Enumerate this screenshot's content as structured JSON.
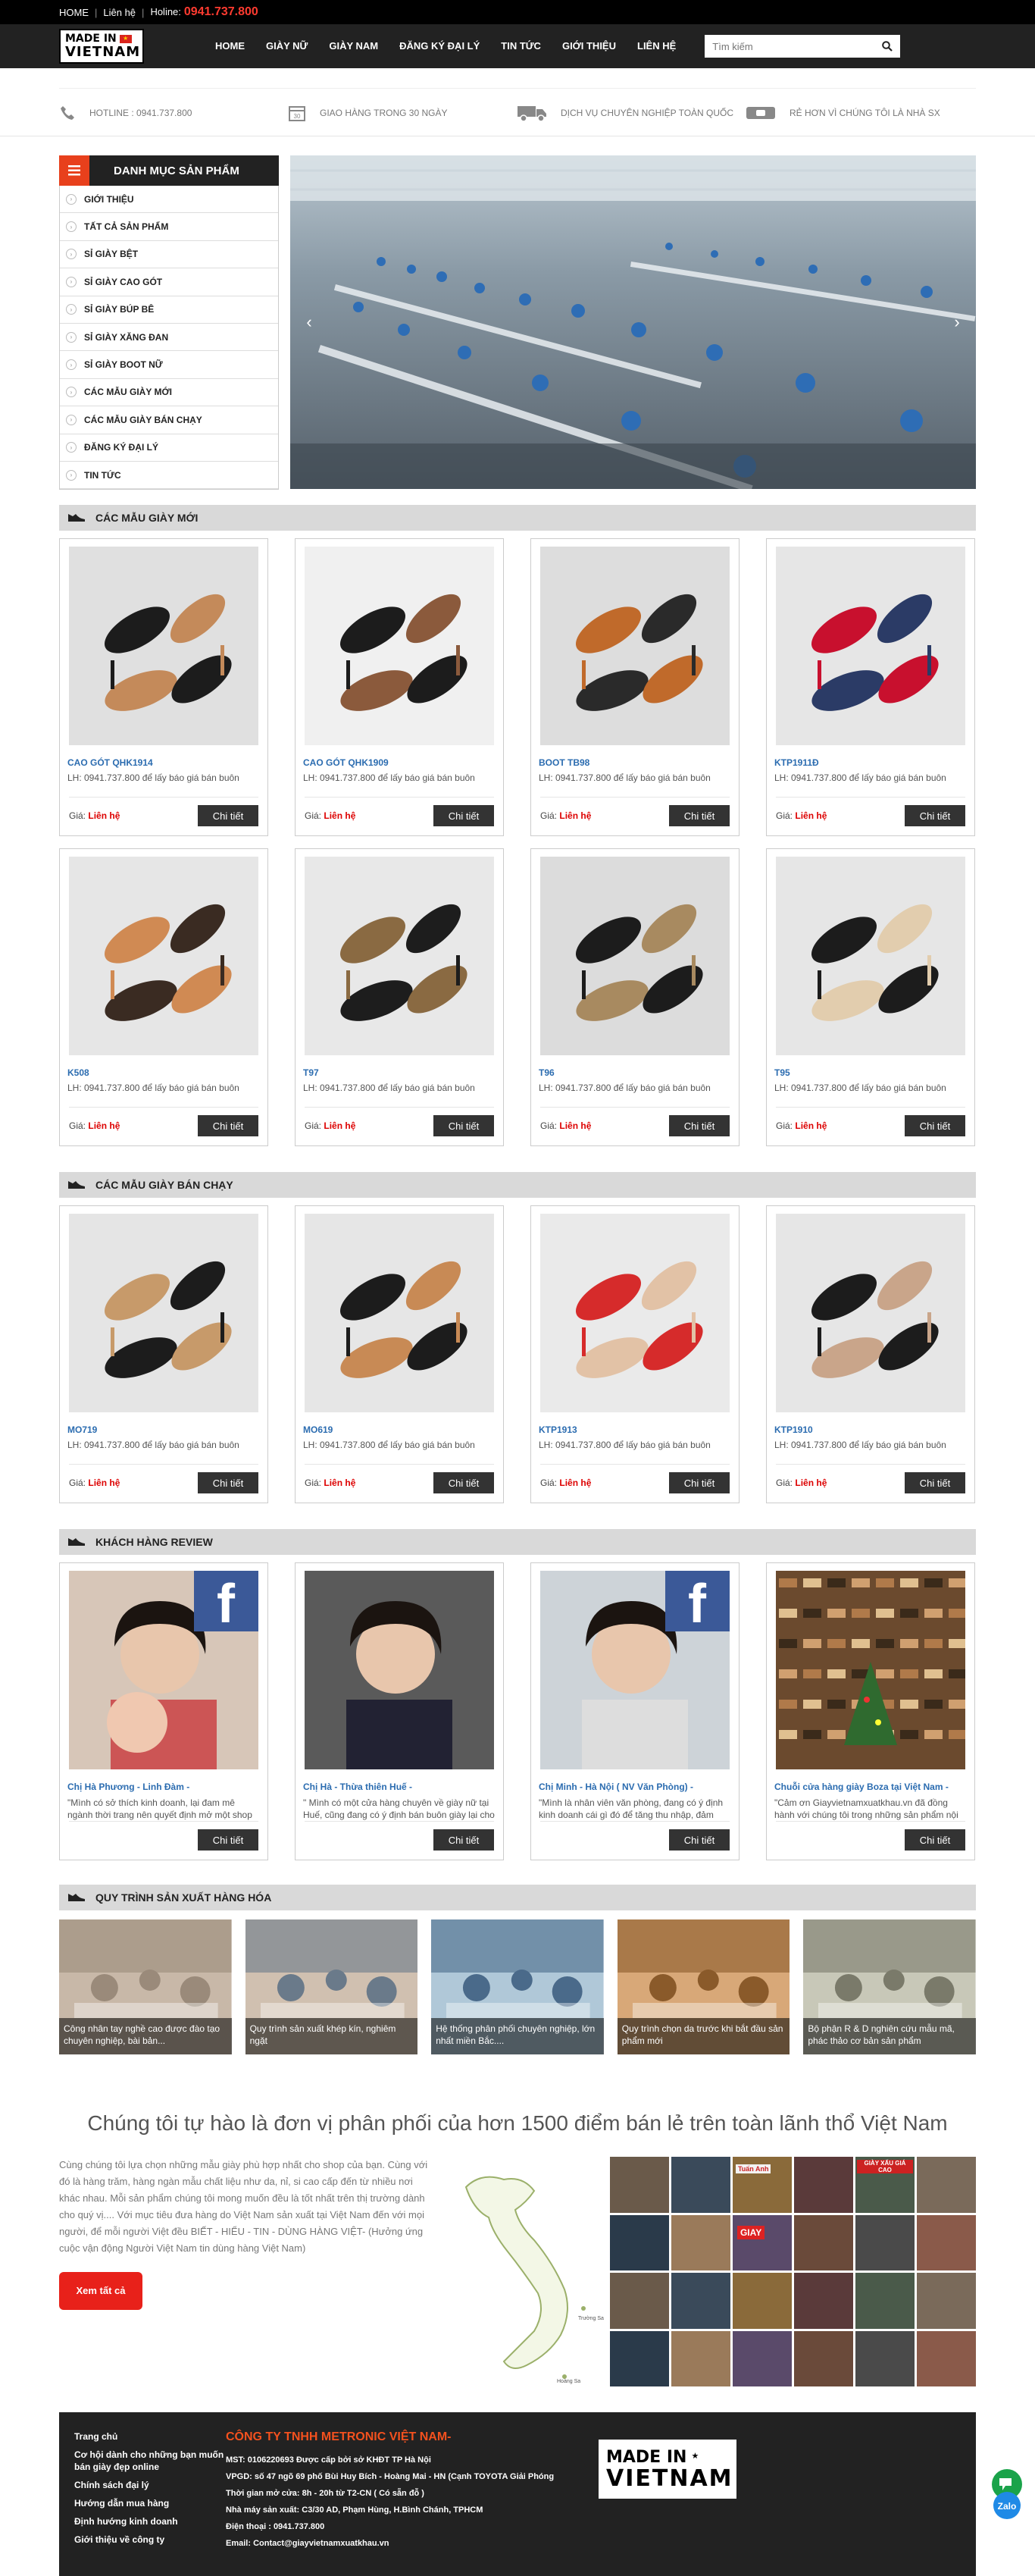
{
  "topbar": {
    "home": "HOME",
    "contact": "Liên hệ",
    "hotline_label": "Holine:",
    "hotline_number": "0941.737.800"
  },
  "logo": {
    "line1": "MADE IN",
    "line2": "VIETNAM"
  },
  "nav": [
    "HOME",
    "GIÀY NỮ",
    "GIÀY NAM",
    "ĐĂNG KÝ ĐẠI LÝ",
    "TIN TỨC",
    "GIỚI THIỆU",
    "LIÊN HỆ"
  ],
  "search": {
    "placeholder": "Tìm kiếm"
  },
  "features": [
    {
      "icon": "phone-icon",
      "text": "HOTLINE : 0941.737.800"
    },
    {
      "icon": "calendar-icon",
      "text": "GIAO HÀNG TRONG 30 NGÀY"
    },
    {
      "icon": "truck-icon",
      "text": "DỊCH VỤ CHUYÊN NGHIỆP TOÀN QUỐC"
    },
    {
      "icon": "wallet-icon",
      "text": "RẺ HƠN VÌ CHÚNG TÔI LÀ NHÀ SX"
    }
  ],
  "categories": {
    "title": "DANH MỤC SẢN PHẨM",
    "items": [
      "GIỚI THIỆU",
      "TẤT CẢ SẢN PHẨM",
      "SỈ GIÀY BỆT",
      "SỈ GIÀY CAO GÓT",
      "SỈ GIÀY BÚP BÊ",
      "SỈ GIÀY XĂNG ĐAN",
      "SỈ GIÀY BOOT NỮ",
      "CÁC MẪU GIÀY MỚI",
      "CÁC MẪU GIÀY BÁN CHẠY",
      "ĐĂNG KÝ ĐẠI LÝ",
      "TIN TỨC"
    ]
  },
  "sections": {
    "new": "CÁC MẪU GIÀY MỚI",
    "best": "CÁC MẪU GIÀY BÁN CHẠY",
    "review": "KHÁCH HÀNG REVIEW",
    "process": "QUY TRÌNH SẢN XUẤT HÀNG HÓA"
  },
  "product_common": {
    "desc": "LH: 0941.737.800 để lấy báo giá bán buôn",
    "price_label": "Giá:",
    "price_value": "Liên hệ",
    "button": "Chi tiết"
  },
  "new_products": [
    {
      "name": "CAO GÓT QHK1914",
      "tag": ""
    },
    {
      "name": "CAO GÓT QHK1909",
      "tag": ""
    },
    {
      "name": "BOOT TB98",
      "tag": "TB98"
    },
    {
      "name": "KTP1911Đ",
      "tag": "KTP1911Đ"
    },
    {
      "name": "K508",
      "tag": ""
    },
    {
      "name": "T97",
      "tag": ""
    },
    {
      "name": "T96",
      "tag": ""
    },
    {
      "name": "T95",
      "tag": ""
    }
  ],
  "best_products": [
    {
      "name": "MO719"
    },
    {
      "name": "MO619"
    },
    {
      "name": "KTP1913"
    },
    {
      "name": "KTP1910"
    }
  ],
  "reviews": [
    {
      "name": "Chị Hà Phương - Linh Đàm -",
      "text": "\"Mình có sở thích kinh doanh, lại đam mê ngành thời trang nên quyết định mở một shop"
    },
    {
      "name": "Chị Hà - Thừa thiên Huế -",
      "text": "\" Mình có một cửa hàng chuyên về giày nữ tại Huế, cũng đang có ý định bán buôn giày lại cho"
    },
    {
      "name": "Chị Minh - Hà Nội ( NV Văn Phòng) -",
      "text": "\"Mình là nhân viên văn phòng, đang có ý định kinh doanh cái gì đó để tăng thu nhập, đảm"
    },
    {
      "name": "Chuỗi cửa hàng giày Boza tại Việt Nam -",
      "text": "\"Cảm ơn Giayvietnamxuatkhau.vn đã đồng hành với chúng tôi trong những sản phẩm nội"
    }
  ],
  "process": [
    "Công nhân tay nghề cao được đào tạo chuyên nghiệp, bài bản...",
    "Quy trình sản xuất khép kín, nghiêm ngặt",
    "Hệ thống phân phối chuyên nghiệp, lớn nhất miền Bắc....",
    "Quy trình chọn da trước khi bắt đầu sản phẩm mới",
    "Bộ phận R & D nghiên cứu mẫu mã, phác thảo cơ bản sản phẩm"
  ],
  "about": {
    "title": "Chúng tôi tự hào là đơn vị phân phối của hơn 1500 điểm bán lẻ trên toàn lãnh thổ Việt Nam",
    "text": "Cùng chúng tôi lựa chọn những mẫu giày phù hợp nhất cho shop của bạn. Cùng với đó là hàng trăm, hàng ngàn mẫu chất liệu như da, nỉ, si cao cấp đến từ nhiều nơi khác nhau. Mỗi sản phẩm chúng tôi mong muốn đều là tốt nhất trên thị trường dành cho quý vị.... Với mục tiêu đưa hàng do Việt Nam sản xuất tại Việt Nam đến với mọi người, để mỗi người Việt đều BIẾT - HIỂU - TIN - DÙNG HÀNG VIỆT- (Hưởng ứng cuộc vận động Người Việt Nam tin dùng hàng Việt Nam)",
    "button": "Xem tất cả",
    "map_labels": [
      "Trường Sa",
      "Hoàng Sa"
    ],
    "store_signs": [
      "GIÀY XẤU GIÁ CAO",
      "GIAY",
      "Tuấn Anh"
    ]
  },
  "footer": {
    "links": [
      "Trang chủ",
      "Cơ hội dành cho những bạn muốn bán giày đẹp online",
      "Chính sách đại lý",
      "Hướng dẫn mua hàng",
      "Định hướng kinh doanh",
      "Giới thiệu về công ty"
    ],
    "company": "CÔNG TY TNHH METRONIC VIỆT NAM-",
    "lines": [
      "MST: 0106220693 Được cấp bởi sở KHĐT TP Hà Nội",
      "VPGD: số 47 ngõ 69 phố Bùi Huy Bích - Hoàng Mai - HN (Cạnh TOYOTA Giải Phóng",
      "Thời gian mở cửa: 8h - 20h từ T2-CN ( Có sẵn đỗ )",
      "Nhà máy sản xuất: C3/30 AD, Phạm Hùng, H.Bình Chánh, TPHCM",
      "Điện thoại : 0941.737.800",
      "Email: Contact@giayvietnamxuatkhau.vn"
    ]
  },
  "zalo": "Zalo",
  "colors": {
    "accent": "#e8401c",
    "dark": "#222222",
    "link": "#2b6cb0",
    "price": "#dd0000"
  }
}
